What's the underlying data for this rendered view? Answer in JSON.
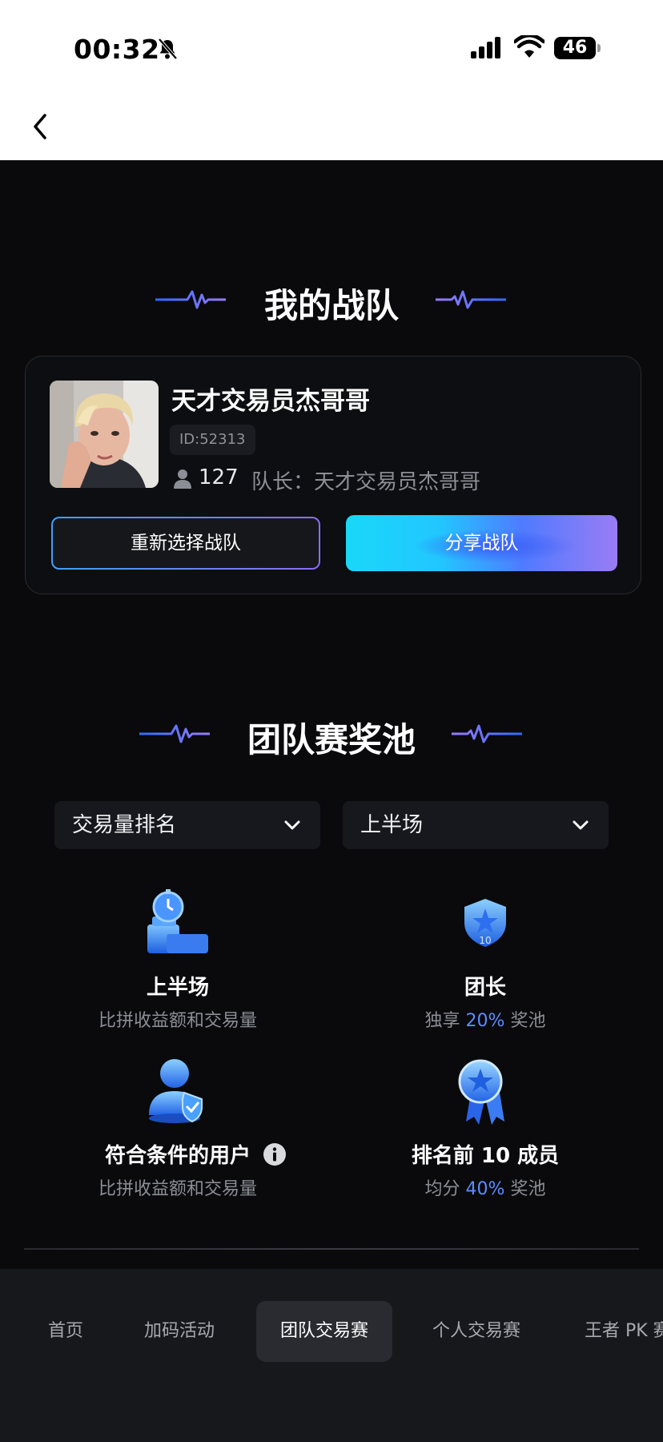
{
  "status_bar": {
    "time": "00:32",
    "battery": "46"
  },
  "team_section": {
    "title": "我的战队",
    "team_name": "天才交易员杰哥哥",
    "team_id": "ID:52313",
    "member_count": "127",
    "leader": "队长：天才交易员杰哥哥",
    "reselect_label": "重新选择战队",
    "share_label": "分享战队"
  },
  "pool_section": {
    "title": "团队赛奖池",
    "rank_dropdown": "交易量排名",
    "half_dropdown": "上半场",
    "rewards": [
      {
        "title": "上半场",
        "desc_before": "比拼收益额和交易量",
        "highlight": "",
        "desc_after": ""
      },
      {
        "title": "团长",
        "desc_before": "独享 ",
        "highlight": "20%",
        "desc_after": " 奖池"
      },
      {
        "title": "符合条件的用户",
        "desc_before": "比拼收益额和交易量",
        "highlight": "",
        "desc_after": ""
      },
      {
        "title": "排名前 10 成员",
        "desc_before": "均分 ",
        "highlight": "40%",
        "desc_after": " 奖池"
      }
    ]
  },
  "tabs": [
    "首页",
    "加码活动",
    "团队交易赛",
    "个人交易赛",
    "王者 PK 赛"
  ],
  "icons": [
    "bell-slash-icon",
    "cellular-signal-icon",
    "wifi-icon",
    "battery-icon",
    "back-chevron-icon",
    "person-icon",
    "chevron-down-icon",
    "stopwatch-trophy-icon",
    "shield-star-badge-icon",
    "user-check-icon",
    "medal-star-icon",
    "info-icon"
  ],
  "colors": {
    "accent_blue": "#5a8dff",
    "share_gradient_start": "#19d8f8",
    "share_gradient_end": "#9a7cf4"
  }
}
